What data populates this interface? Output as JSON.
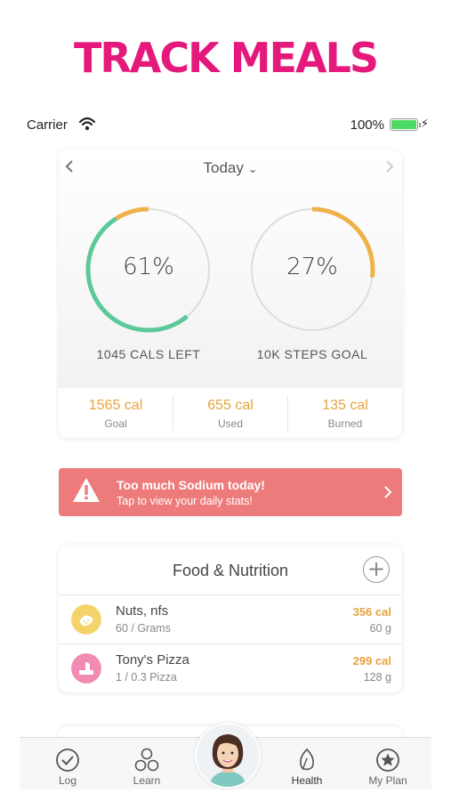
{
  "promo": {
    "headline": "TRACK MEALS"
  },
  "status_bar": {
    "carrier": "Carrier",
    "battery": "100%"
  },
  "summary": {
    "date_label": "Today",
    "date_chevron": "⌄",
    "calories_ring": {
      "percent_label": "61%",
      "progress": 0.61,
      "caption": "1045 CALS LEFT"
    },
    "steps_ring": {
      "percent_label": "27%",
      "progress": 0.27,
      "caption": "10K STEPS GOAL"
    },
    "stats": [
      {
        "value": "1565 cal",
        "label": "Goal"
      },
      {
        "value": "655 cal",
        "label": "Used"
      },
      {
        "value": "135 cal",
        "label": "Burned"
      }
    ]
  },
  "alert": {
    "title": "Too much Sodium today!",
    "subtitle": "Tap to view your daily stats!"
  },
  "food": {
    "title": "Food & Nutrition",
    "items": [
      {
        "name": "Nuts, nfs",
        "quantity": "60 / Grams",
        "calories": "356 cal",
        "weight": "60 g",
        "icon": "nuts-icon",
        "color": "#f5d36b"
      },
      {
        "name": "Tony's Pizza",
        "quantity": "1 / 0.3 Pizza",
        "calories": "299 cal",
        "weight": "128 g",
        "icon": "pizza-icon",
        "color": "#f28bb3"
      }
    ]
  },
  "tabs": [
    {
      "label": "Log",
      "icon": "check-circle-icon"
    },
    {
      "label": "Learn",
      "icon": "circles-icon"
    },
    {
      "label": "Health",
      "icon": "leaf-icon"
    },
    {
      "label": "My Plan",
      "icon": "star-circle-icon"
    }
  ],
  "colors": {
    "accent_pink": "#e5197b",
    "ring_green": "#5dc99a",
    "ring_orange": "#efb24a",
    "alert_red": "#ee7b7b",
    "value_orange": "#e8a33d"
  }
}
